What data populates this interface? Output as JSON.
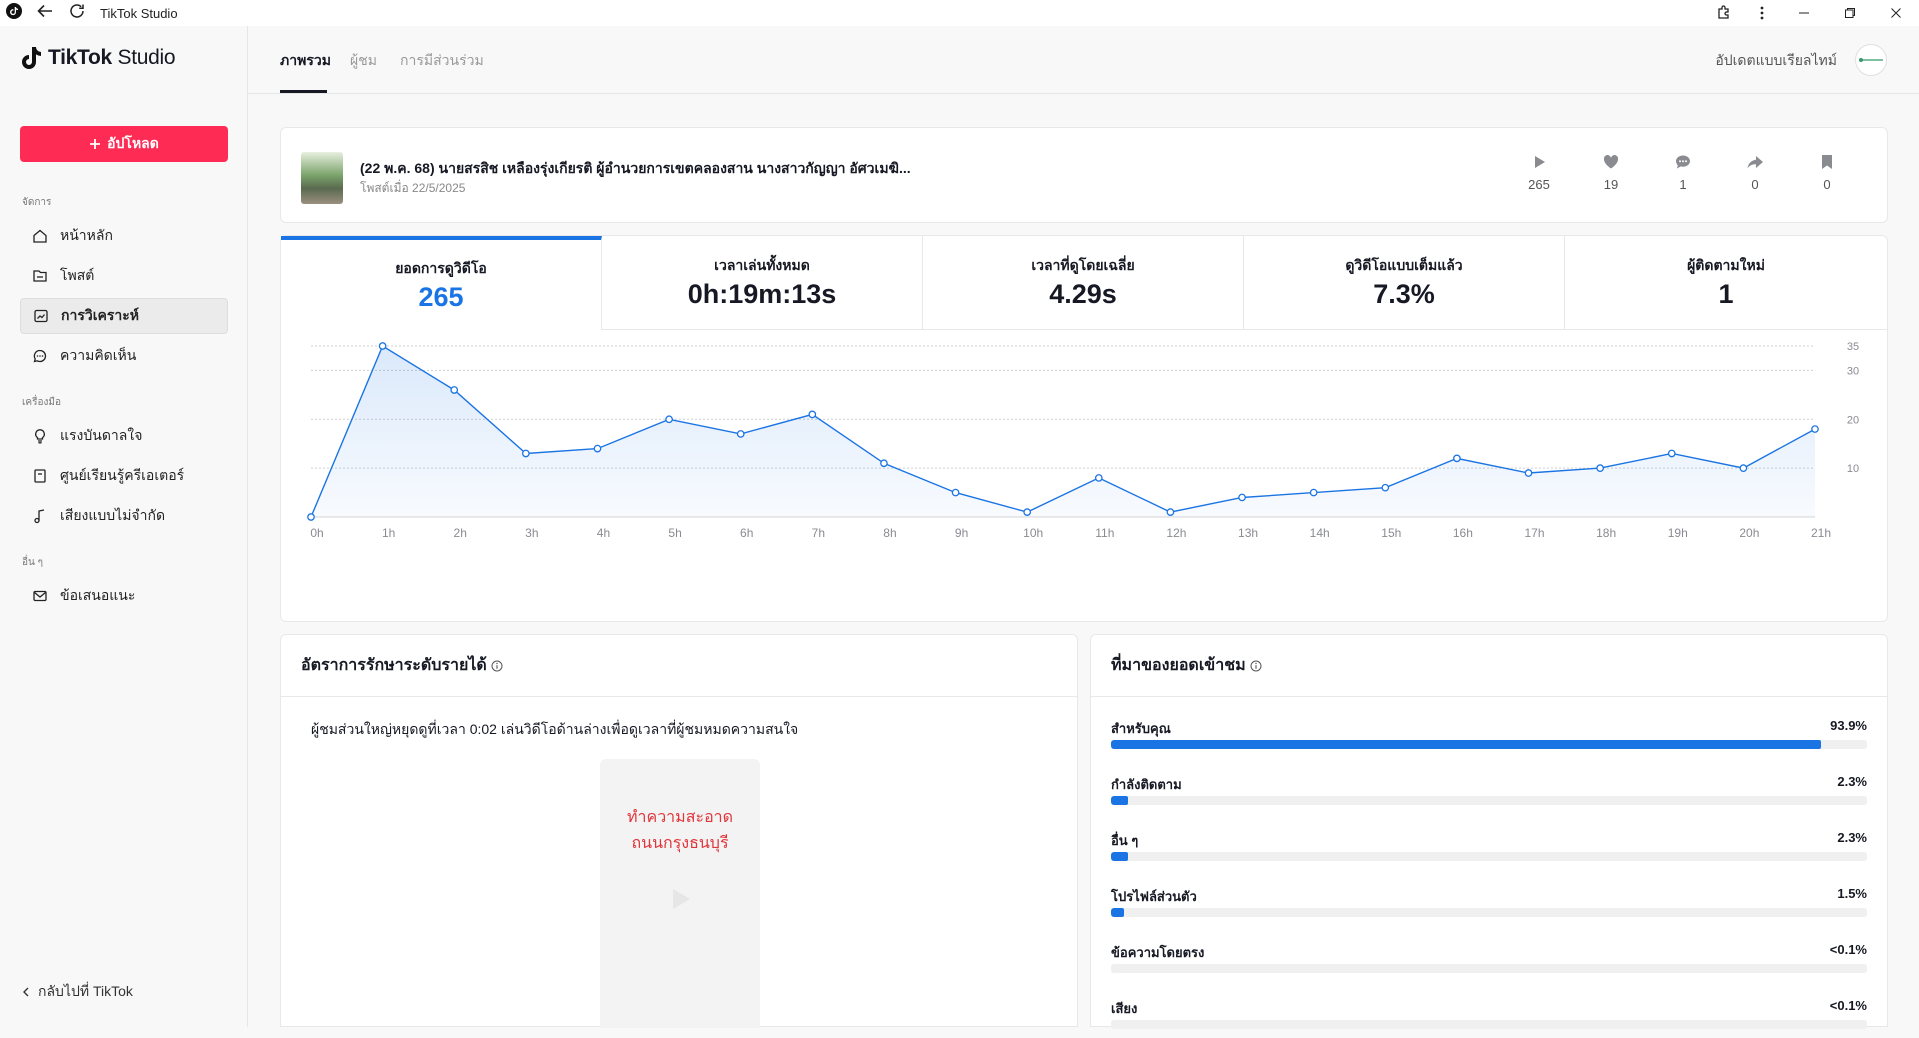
{
  "window": {
    "title": "TikTok Studio"
  },
  "brand": {
    "logo_bold": "TikTok",
    "logo_light": " Studio"
  },
  "sidebar": {
    "upload_label": "อัปโหลด",
    "sections": [
      {
        "label": "จัดการ"
      },
      {
        "label": "เครื่องมือ"
      },
      {
        "label": "อื่น ๆ"
      }
    ],
    "items": [
      {
        "label": "หน้าหลัก",
        "icon": "home-icon"
      },
      {
        "label": "โพสต์",
        "icon": "posts-icon"
      },
      {
        "label": "การวิเคราะห์",
        "icon": "analytics-icon",
        "active": true
      },
      {
        "label": "ความคิดเห็น",
        "icon": "comment-icon"
      },
      {
        "label": "แรงบันดาลใจ",
        "icon": "lightbulb-icon"
      },
      {
        "label": "ศูนย์เรียนรู้ครีเอเตอร์",
        "icon": "book-icon"
      },
      {
        "label": "เสียงแบบไม่จำกัด",
        "icon": "music-note-icon"
      },
      {
        "label": "ข้อเสนอแนะ",
        "icon": "mail-icon"
      }
    ],
    "back_label": "กลับไปที่ TikTok"
  },
  "topnav": {
    "tabs": [
      {
        "label": "ภาพรวม",
        "active": true
      },
      {
        "label": "ผู้ชม"
      },
      {
        "label": "การมีส่วนร่วม"
      }
    ],
    "realtime_label": "อัปเดตแบบเรียลไทม์"
  },
  "post": {
    "title": "(22 พ.ค. 68) นายสรสิช เหลืองรุ่งเกียรติ ผู้อำนวยการเขตคลองสาน นางสาวกัญญา อัศวเมฆิ...",
    "date": "โพสต์เมื่อ 22/5/2025",
    "stats": [
      {
        "icon": "play-icon",
        "value": "265"
      },
      {
        "icon": "heart-icon",
        "value": "19"
      },
      {
        "icon": "comment-bubble-icon",
        "value": "1"
      },
      {
        "icon": "share-icon",
        "value": "0"
      },
      {
        "icon": "bookmark-icon",
        "value": "0"
      }
    ]
  },
  "metrics": [
    {
      "label": "ยอดการดูวิดีโอ",
      "value": "265",
      "active": true
    },
    {
      "label": "เวลาเล่นทั้งหมด",
      "value": "0h:19m:13s"
    },
    {
      "label": "เวลาที่ดูโดยเฉลี่ย",
      "value": "4.29s"
    },
    {
      "label": "ดูวิดีโอแบบเต็มแล้ว",
      "value": "7.3%"
    },
    {
      "label": "ผู้ติดตามใหม่",
      "value": "1"
    }
  ],
  "chart_data": {
    "type": "area",
    "x": [
      "0h",
      "1h",
      "2h",
      "3h",
      "4h",
      "5h",
      "6h",
      "7h",
      "8h",
      "9h",
      "10h",
      "11h",
      "12h",
      "13h",
      "14h",
      "15h",
      "16h",
      "17h",
      "18h",
      "19h",
      "20h",
      "21h"
    ],
    "series": [
      {
        "values": [
          0,
          35,
          26,
          13,
          14,
          20,
          17,
          21,
          11,
          5,
          1,
          8,
          1,
          4,
          5,
          6,
          12,
          9,
          10,
          13,
          10,
          18
        ]
      }
    ],
    "yticks": [
      10,
      20,
      30,
      35
    ],
    "ylim": [
      0,
      35
    ],
    "grid": true,
    "color": "#1b74e4"
  },
  "retention": {
    "title": "อัตราการรักษาระดับรายได้",
    "description": "ผู้ชมส่วนใหญ่หยุดดูที่เวลา 0:02 เล่นวิดีโอด้านล่างเพื่อดูเวลาที่ผู้ชมหมดความสนใจ",
    "video_text_line1": "ทำความสะอาด",
    "video_text_line2": "ถนนกรุงธนบุรี"
  },
  "traffic": {
    "title": "ที่มาของยอดเข้าชม",
    "rows": [
      {
        "label": "สำหรับคุณ",
        "pct": "93.9%",
        "fraction": 0.939
      },
      {
        "label": "กำลังติดตาม",
        "pct": "2.3%",
        "fraction": 0.023
      },
      {
        "label": "อื่น ๆ",
        "pct": "2.3%",
        "fraction": 0.023
      },
      {
        "label": "โปรไฟล์ส่วนตัว",
        "pct": "1.5%",
        "fraction": 0.015
      },
      {
        "label": "ข้อความโดยตรง",
        "pct": "<0.1%",
        "fraction": 0
      },
      {
        "label": "เสียง",
        "pct": "<0.1%",
        "fraction": 0
      }
    ]
  }
}
